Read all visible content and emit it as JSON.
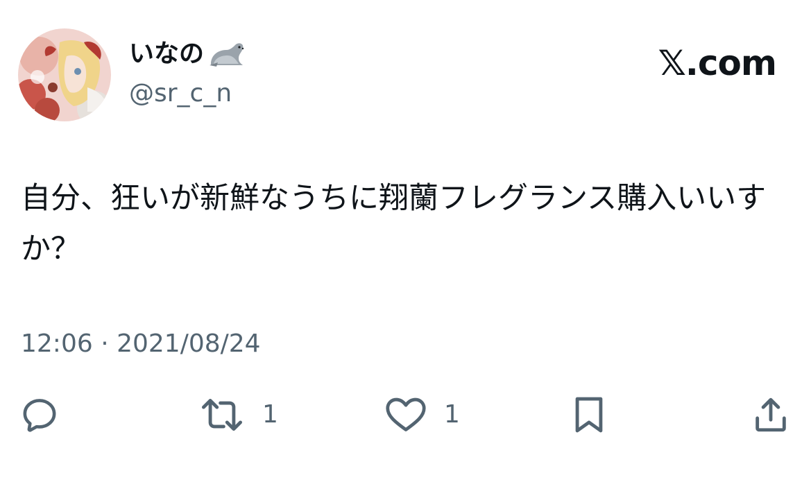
{
  "author": {
    "display_name": "いなの",
    "name_emoji": "seal-icon",
    "handle": "@sr_c_n",
    "avatar": "avatar-illustration"
  },
  "brand": {
    "label": "𝕏.com"
  },
  "tweet": {
    "text": "自分、狂いが新鮮なうちに翔蘭フレグランス購入いいすか？",
    "timestamp": "12:06 · 2021/08/24"
  },
  "actions": {
    "reply": {
      "icon": "reply-icon",
      "count": ""
    },
    "retweet": {
      "icon": "retweet-icon",
      "count": "1"
    },
    "like": {
      "icon": "heart-icon",
      "count": "1"
    },
    "bookmark": {
      "icon": "bookmark-icon"
    },
    "share": {
      "icon": "share-icon"
    }
  },
  "colors": {
    "text": "#0f1419",
    "secondary": "#536471",
    "background": "#ffffff"
  }
}
